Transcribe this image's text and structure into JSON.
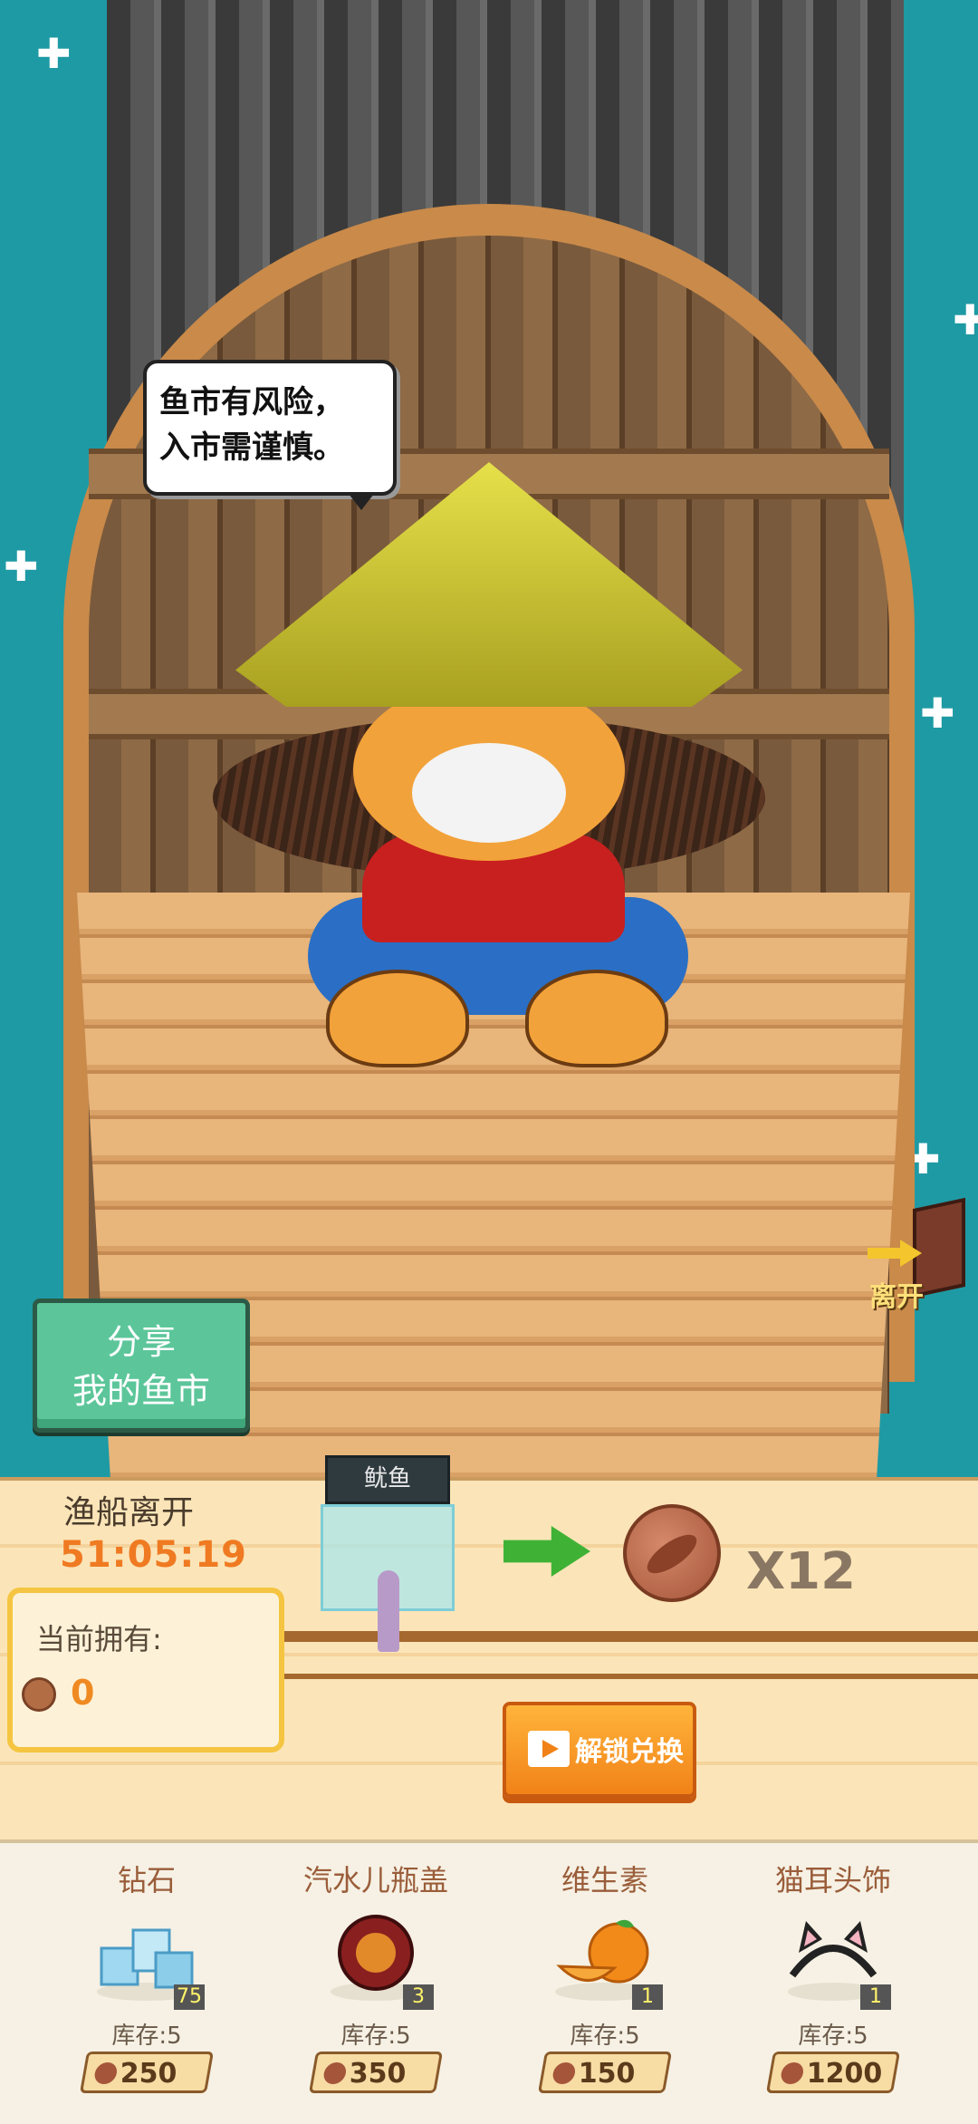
{
  "speech_bubble": {
    "line1": "鱼市有风险，",
    "line2": "入市需谨慎。"
  },
  "share_button": {
    "line1": "分享",
    "line2": "我的鱼市"
  },
  "leave_button": {
    "label": "离开"
  },
  "trade": {
    "depart_label": "渔船离开",
    "timer": "51:05:19",
    "item_name": "鱿鱼",
    "multiplier": "X12"
  },
  "owned": {
    "label": "当前拥有:",
    "count": "0"
  },
  "unlock_button": {
    "label": "解锁兑换"
  },
  "shop": [
    {
      "name": "钻石",
      "badge": "75",
      "stock": "库存:5",
      "price": "250"
    },
    {
      "name": "汽水儿瓶盖",
      "badge": "3",
      "stock": "库存:5",
      "price": "350"
    },
    {
      "name": "维生素",
      "badge": "1",
      "stock": "库存:5",
      "price": "150"
    },
    {
      "name": "猫耳头饰",
      "badge": "1",
      "stock": "库存:5",
      "price": "1200"
    }
  ],
  "colors": {
    "sea": "#1e9aa4",
    "timer": "#ef7a22",
    "share_button": "#5cc69a",
    "unlock_button": "#f18218"
  }
}
